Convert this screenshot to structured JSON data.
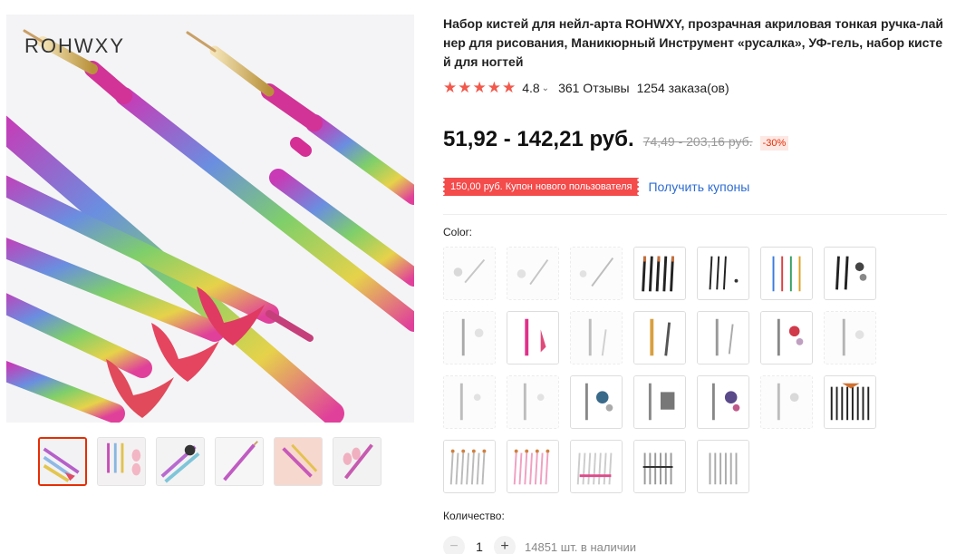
{
  "gallery": {
    "brand": "ROHWXY",
    "thumbnails": [
      "thumb-1",
      "thumb-2",
      "thumb-3",
      "thumb-4",
      "thumb-5",
      "thumb-6"
    ]
  },
  "product": {
    "title": "Набор кистей для нейл-арта ROHWXY, прозрачная акриловая тонкая ручка-лайнер для рисования, Маникюрный Инструмент «русалка», УФ-гель, набор кистей для ногтей",
    "stars": "★★★★★",
    "rating": "4.8",
    "reviews": "361 Отзывы",
    "orders": "1254 заказа(ов)"
  },
  "price": {
    "current": "51,92 - 142,21 руб.",
    "old": "74,49 - 203,16 руб.",
    "discount": "-30%"
  },
  "coupon": {
    "label": "150,00 руб. Купон нового пользователя",
    "link": "Получить купоны"
  },
  "color": {
    "label": "Color:",
    "rows": [
      7,
      7,
      7,
      5
    ]
  },
  "quantity": {
    "label": "Количество:",
    "minus": "−",
    "plus": "+",
    "value": "1",
    "stock": "14851 шт. в наличии"
  },
  "colors": {
    "accent": "#e62e04",
    "stars": "#f2584b",
    "coupon_bg": "#f44b4b",
    "link": "#2e6cd1"
  }
}
